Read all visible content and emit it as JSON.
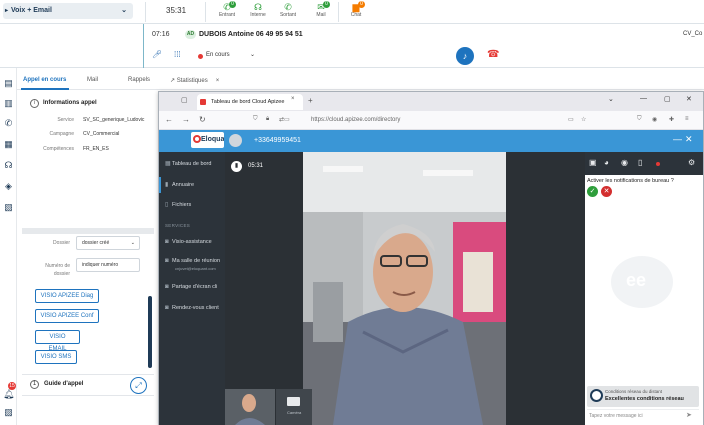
{
  "topbar": {
    "mode_label": "Voix + Email",
    "timer": "35:31",
    "items": [
      {
        "label": "Entrant",
        "badge": "0",
        "badge_color": "#2e9e3b",
        "icon": "incoming-call-icon"
      },
      {
        "label": "Interne",
        "badge": "",
        "icon": "headset-icon"
      },
      {
        "label": "Sortant",
        "badge": "",
        "icon": "outgoing-call-icon"
      },
      {
        "label": "Mail",
        "badge": "0",
        "badge_color": "#2e9e3b",
        "icon": "mail-icon"
      },
      {
        "label": "Chat",
        "badge": "0",
        "badge_color": "#f57c00",
        "icon": "chat-icon"
      }
    ]
  },
  "call": {
    "duration": "07:16",
    "avatar_initials": "AD",
    "caller": "DUBOIS Antoine 06 49 95 94 51",
    "status": "En cours",
    "right_label": "CV_Co"
  },
  "tabs": {
    "active": "Appel en cours",
    "mail": "Mail",
    "rappels": "Rappels",
    "statistiques": "Statistiques"
  },
  "info": {
    "title": "Informations appel",
    "fields": [
      {
        "label": "Service",
        "value": "SV_SC_generique_Ludovic"
      },
      {
        "label": "Campagne",
        "value": "CV_Commercial"
      },
      {
        "label": "Compétences",
        "value": "FR_EN_ES"
      }
    ]
  },
  "form": {
    "dossier_label": "Dossier",
    "dossier_value": "dossier créé",
    "numero_label_1": "Numéro de",
    "numero_label_2": "dossier",
    "numero_placeholder": "indiquer numéro"
  },
  "buttons": [
    "VISIO APIZEE Diag",
    "VISIO APIZEE Conf",
    "VISIO EMAIL",
    "VISIO SMS"
  ],
  "guide": {
    "number": "1",
    "title": "Guide d'appel"
  },
  "rail": {
    "notification_count": "15"
  },
  "browser": {
    "tab_title": "Tableau de bord Cloud Apizee",
    "url": "https://cloud.apizee.com/directory"
  },
  "app": {
    "logo_text": "Eloquant",
    "phone": "+33649959451",
    "sidebar": {
      "dashboard": "Tableau de bord",
      "directory": "Annuaire",
      "files": "Fichiers",
      "section": "SERVICES",
      "visio": "Visio-assistance",
      "room": "Ma salle de réunion",
      "room_sub": "cnjuvet@eloquant.com",
      "share": "Partage d'écran cli",
      "appointments": "Rendez-vous client"
    },
    "call_timer": "05:31",
    "camera_label": "Caméra",
    "notification_question": "Activer les notifications de bureau ?",
    "network_label": "Conditions réseau du distant",
    "network_value": "Excellentes conditions réseau",
    "message_placeholder": "Tapez votre message ici"
  },
  "colors": {
    "accent": "#1e73be",
    "app_header": "#3a96d6",
    "app_dark": "#2c333a",
    "danger": "#e53935",
    "success": "#2e9e3b"
  }
}
